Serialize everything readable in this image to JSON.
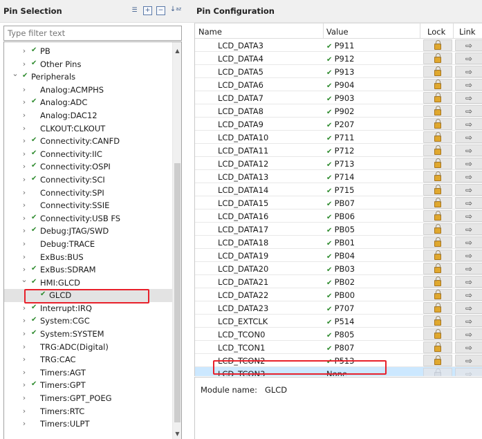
{
  "pin_selection": {
    "title": "Pin Selection",
    "toolbar_icons": [
      "list-icon",
      "expand-all-icon",
      "collapse-all-icon",
      "sort-az-icon"
    ],
    "filter_placeholder": "Type filter text",
    "tree": [
      {
        "label": "PB",
        "indent": 1,
        "twisty": "collapsed",
        "checked": true
      },
      {
        "label": "Other Pins",
        "indent": 1,
        "twisty": "collapsed",
        "checked": true
      },
      {
        "label": "Peripherals",
        "indent": 0,
        "twisty": "expanded",
        "checked": true
      },
      {
        "label": "Analog:ACMPHS",
        "indent": 1,
        "twisty": "collapsed",
        "checked": false
      },
      {
        "label": "Analog:ADC",
        "indent": 1,
        "twisty": "collapsed",
        "checked": true
      },
      {
        "label": "Analog:DAC12",
        "indent": 1,
        "twisty": "collapsed",
        "checked": false
      },
      {
        "label": "CLKOUT:CLKOUT",
        "indent": 1,
        "twisty": "collapsed",
        "checked": false
      },
      {
        "label": "Connectivity:CANFD",
        "indent": 1,
        "twisty": "collapsed",
        "checked": true
      },
      {
        "label": "Connectivity:IIC",
        "indent": 1,
        "twisty": "collapsed",
        "checked": true
      },
      {
        "label": "Connectivity:OSPI",
        "indent": 1,
        "twisty": "collapsed",
        "checked": true
      },
      {
        "label": "Connectivity:SCI",
        "indent": 1,
        "twisty": "collapsed",
        "checked": true
      },
      {
        "label": "Connectivity:SPI",
        "indent": 1,
        "twisty": "collapsed",
        "checked": false
      },
      {
        "label": "Connectivity:SSIE",
        "indent": 1,
        "twisty": "collapsed",
        "checked": false
      },
      {
        "label": "Connectivity:USB FS",
        "indent": 1,
        "twisty": "collapsed",
        "checked": true
      },
      {
        "label": "Debug:JTAG/SWD",
        "indent": 1,
        "twisty": "collapsed",
        "checked": true
      },
      {
        "label": "Debug:TRACE",
        "indent": 1,
        "twisty": "collapsed",
        "checked": false
      },
      {
        "label": "ExBus:BUS",
        "indent": 1,
        "twisty": "collapsed",
        "checked": false
      },
      {
        "label": "ExBus:SDRAM",
        "indent": 1,
        "twisty": "collapsed",
        "checked": true
      },
      {
        "label": "HMI:GLCD",
        "indent": 1,
        "twisty": "expanded",
        "checked": true
      },
      {
        "label": "GLCD",
        "indent": 2,
        "twisty": "none",
        "checked": true,
        "selected": true
      },
      {
        "label": "Interrupt:IRQ",
        "indent": 1,
        "twisty": "collapsed",
        "checked": true
      },
      {
        "label": "System:CGC",
        "indent": 1,
        "twisty": "collapsed",
        "checked": true
      },
      {
        "label": "System:SYSTEM",
        "indent": 1,
        "twisty": "collapsed",
        "checked": true
      },
      {
        "label": "TRG:ADC(Digital)",
        "indent": 1,
        "twisty": "collapsed",
        "checked": false
      },
      {
        "label": "TRG:CAC",
        "indent": 1,
        "twisty": "collapsed",
        "checked": false
      },
      {
        "label": "Timers:AGT",
        "indent": 1,
        "twisty": "collapsed",
        "checked": false
      },
      {
        "label": "Timers:GPT",
        "indent": 1,
        "twisty": "collapsed",
        "checked": true
      },
      {
        "label": "Timers:GPT_POEG",
        "indent": 1,
        "twisty": "collapsed",
        "checked": false
      },
      {
        "label": "Timers:RTC",
        "indent": 1,
        "twisty": "collapsed",
        "checked": false
      },
      {
        "label": "Timers:ULPT",
        "indent": 1,
        "twisty": "collapsed",
        "checked": false
      }
    ]
  },
  "pin_configuration": {
    "title": "Pin Configuration",
    "columns": {
      "name": "Name",
      "value": "Value",
      "lock": "Lock",
      "link": "Link"
    },
    "rows": [
      {
        "name": "LCD_DATA3",
        "value": "P911",
        "ok": true
      },
      {
        "name": "LCD_DATA4",
        "value": "P912",
        "ok": true
      },
      {
        "name": "LCD_DATA5",
        "value": "P913",
        "ok": true
      },
      {
        "name": "LCD_DATA6",
        "value": "P904",
        "ok": true
      },
      {
        "name": "LCD_DATA7",
        "value": "P903",
        "ok": true
      },
      {
        "name": "LCD_DATA8",
        "value": "P902",
        "ok": true
      },
      {
        "name": "LCD_DATA9",
        "value": "P207",
        "ok": true
      },
      {
        "name": "LCD_DATA10",
        "value": "P711",
        "ok": true
      },
      {
        "name": "LCD_DATA11",
        "value": "P712",
        "ok": true
      },
      {
        "name": "LCD_DATA12",
        "value": "P713",
        "ok": true
      },
      {
        "name": "LCD_DATA13",
        "value": "P714",
        "ok": true
      },
      {
        "name": "LCD_DATA14",
        "value": "P715",
        "ok": true
      },
      {
        "name": "LCD_DATA15",
        "value": "PB07",
        "ok": true
      },
      {
        "name": "LCD_DATA16",
        "value": "PB06",
        "ok": true
      },
      {
        "name": "LCD_DATA17",
        "value": "PB05",
        "ok": true
      },
      {
        "name": "LCD_DATA18",
        "value": "PB01",
        "ok": true
      },
      {
        "name": "LCD_DATA19",
        "value": "PB04",
        "ok": true
      },
      {
        "name": "LCD_DATA20",
        "value": "PB03",
        "ok": true
      },
      {
        "name": "LCD_DATA21",
        "value": "PB02",
        "ok": true
      },
      {
        "name": "LCD_DATA22",
        "value": "PB00",
        "ok": true
      },
      {
        "name": "LCD_DATA23",
        "value": "P707",
        "ok": true
      },
      {
        "name": "LCD_EXTCLK",
        "value": "P514",
        "ok": true
      },
      {
        "name": "LCD_TCON0",
        "value": "P805",
        "ok": true
      },
      {
        "name": "LCD_TCON1",
        "value": "P807",
        "ok": true
      },
      {
        "name": "LCD_TCON2",
        "value": "P513",
        "ok": true
      },
      {
        "name": "LCD_TCON3",
        "value": "None",
        "ok": false,
        "highlighted": true
      }
    ],
    "module_label": "Module name:",
    "module_name": "GLCD"
  },
  "colors": {
    "check": "#2e8b2e",
    "highlight_row": "#cce8ff",
    "annotation_box": "#e8202a",
    "lock_gold": "#e0a82e"
  }
}
